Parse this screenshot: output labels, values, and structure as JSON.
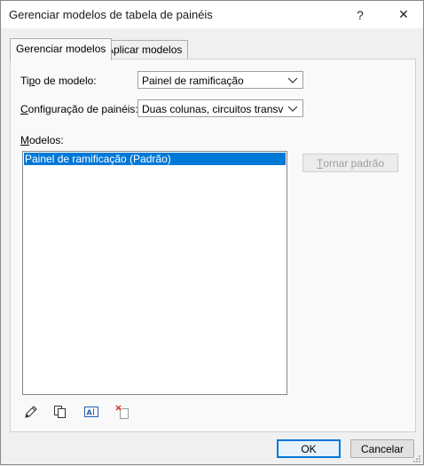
{
  "window": {
    "title": "Gerenciar modelos de tabela de painéis",
    "help_glyph": "?",
    "close_glyph": "✕"
  },
  "tabs": [
    {
      "label": "Gerenciar modelos",
      "active": true
    },
    {
      "label": "Aplicar modelos",
      "active": false
    }
  ],
  "form": {
    "template_type_label_pre": "Ti",
    "template_type_label_mn": "p",
    "template_type_label_post": "o de modelo:",
    "template_type_value": "Painel de ramificação",
    "config_label_pre": "",
    "config_label_mn": "C",
    "config_label_post": "onfiguração de painéis:",
    "config_value": "Duas colunas, circuitos transversa",
    "models_label_pre": "",
    "models_label_mn": "M",
    "models_label_post": "odelos:"
  },
  "models_list": {
    "items": [
      "Painel de ramificação (Padrão)"
    ],
    "selected_index": 0
  },
  "set_default_button": {
    "label_pre": "",
    "label_mn": "T",
    "label_post": "ornar padrão",
    "enabled": false
  },
  "toolbar_icons": [
    "edit-icon",
    "duplicate-icon",
    "rename-icon",
    "delete-icon"
  ],
  "footer": {
    "ok_label": "OK",
    "cancel_label": "Cancelar"
  },
  "colors": {
    "selection": "#0078d7",
    "default_button_border": "#0078d7"
  }
}
